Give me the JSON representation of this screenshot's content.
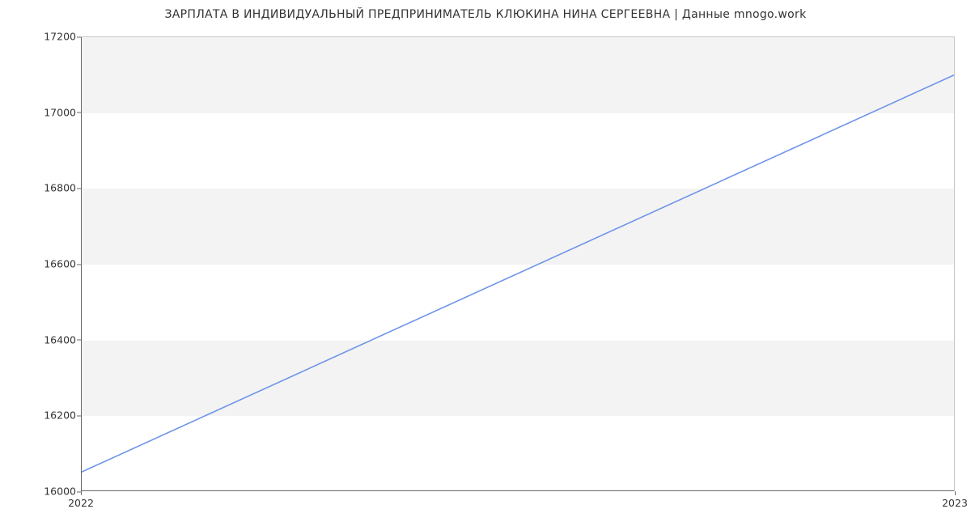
{
  "chart_data": {
    "type": "line",
    "title": "ЗАРПЛАТА В ИНДИВИДУАЛЬНЫЙ ПРЕДПРИНИМАТЕЛЬ КЛЮКИНА НИНА СЕРГЕЕВНА | Данные mnogo.work",
    "xlabel": "",
    "ylabel": "",
    "x": [
      2022,
      2023
    ],
    "values": [
      16050,
      17100
    ],
    "x_ticks": [
      2022,
      2023
    ],
    "y_ticks": [
      16000,
      16200,
      16400,
      16600,
      16800,
      17000,
      17200
    ],
    "ylim": [
      16000,
      17200
    ],
    "xlim": [
      2022,
      2023
    ],
    "grid": "y-bands",
    "line_color": "#6f94e9"
  },
  "ticks": {
    "y0": "16000",
    "y1": "16200",
    "y2": "16400",
    "y3": "16600",
    "y4": "16800",
    "y5": "17000",
    "y6": "17200",
    "x0": "2022",
    "x1": "2023"
  }
}
